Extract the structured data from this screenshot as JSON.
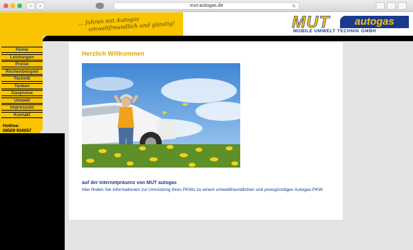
{
  "browser": {
    "url": "mut-autogas.de",
    "back_glyph": "‹",
    "forward_glyph": "›",
    "reload_glyph": "↻"
  },
  "header": {
    "slogan_line1": "... fahren mit Autogas",
    "slogan_line2": "umweltfreundlich und günstig!",
    "logo_mut": "MUT",
    "logo_autogas": "autogas",
    "logo_subtitle": "MOBILE UMWELT TECHNIK GMBH"
  },
  "nav": {
    "items": [
      {
        "label": "Home"
      },
      {
        "label": "Leistungen"
      },
      {
        "label": "Preise"
      },
      {
        "label": "Rechenbeispiel"
      },
      {
        "label": "Technik"
      },
      {
        "label": "Tanken"
      },
      {
        "label": "Gaspreise"
      },
      {
        "label": "Umwelt"
      },
      {
        "label": "Impressum"
      },
      {
        "label": "Kontakt"
      }
    ],
    "hotline_label": "Hotline:",
    "hotline_number": "08509 934057"
  },
  "main": {
    "heading": "Herzlich Willkommen",
    "intro_title": "auf der Internetpräsenz von MUT autogas",
    "intro_text": "Hier finden Sie Informationen zur Umrüstung Ihres PKWs zu einem umweltfreundlichen und preisgünstigen Autogas-PKW."
  },
  "colors": {
    "brand_yellow": "#f9c400",
    "brand_blue": "#1a3a8c",
    "heading_orange": "#e3a600"
  }
}
